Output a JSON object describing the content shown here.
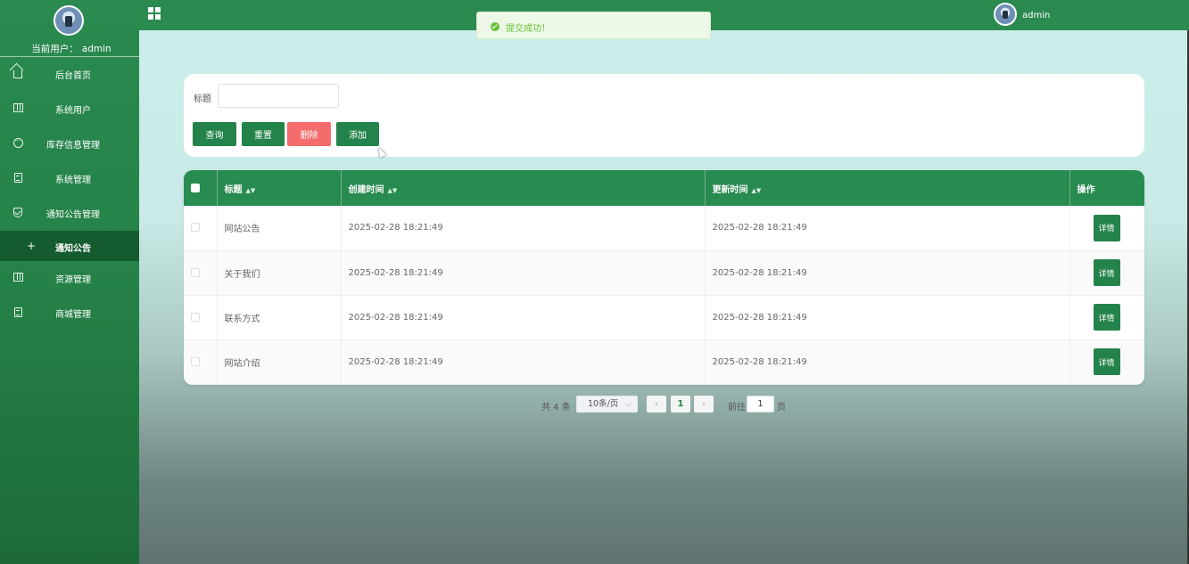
{
  "sidebar": {
    "user_label": "当前用户：",
    "user_name": "admin",
    "items": [
      {
        "label": "后台首页",
        "icon": "home-icon"
      },
      {
        "label": "系统用户",
        "icon": "columns-icon"
      },
      {
        "label": "库存信息管理",
        "icon": "chat-icon"
      },
      {
        "label": "系统管理",
        "icon": "document-icon"
      },
      {
        "label": "通知公告管理",
        "icon": "shield-icon"
      }
    ],
    "active_sub": {
      "label": "通知公告",
      "icon": "plus-icon"
    },
    "items_after": [
      {
        "label": "资源管理",
        "icon": "columns-icon"
      },
      {
        "label": "商城管理",
        "icon": "document-icon"
      }
    ]
  },
  "topbar": {
    "title": "",
    "user": "admin"
  },
  "toast": {
    "message": "提交成功！"
  },
  "search": {
    "label": "标题",
    "value": "",
    "placeholder": "",
    "buttons": {
      "query": "查询",
      "reset": "重置",
      "delete": "删除",
      "add": "添加"
    }
  },
  "table": {
    "columns": [
      "标题",
      "创建时间",
      "更新时间",
      "操作"
    ],
    "rows": [
      {
        "title": "网站公告",
        "created": "2025-02-28 18:21:49",
        "updated": "2025-02-28 18:21:49",
        "action": "详情"
      },
      {
        "title": "关于我们",
        "created": "2025-02-28 18:21:49",
        "updated": "2025-02-28 18:21:49",
        "action": "详情"
      },
      {
        "title": "联系方式",
        "created": "2025-02-28 18:21:49",
        "updated": "2025-02-28 18:21:49",
        "action": "详情"
      },
      {
        "title": "网站介绍",
        "created": "2025-02-28 18:21:49",
        "updated": "2025-02-28 18:21:49",
        "action": "详情"
      }
    ]
  },
  "pagination": {
    "total": "共 4 条",
    "page_size": "10条/页",
    "current_page": "1",
    "goto_label": "前往",
    "goto_value": "1",
    "page_unit": "页"
  },
  "colors": {
    "primary": "#24834a",
    "danger": "#f56c6c",
    "success": "#67c23a"
  }
}
